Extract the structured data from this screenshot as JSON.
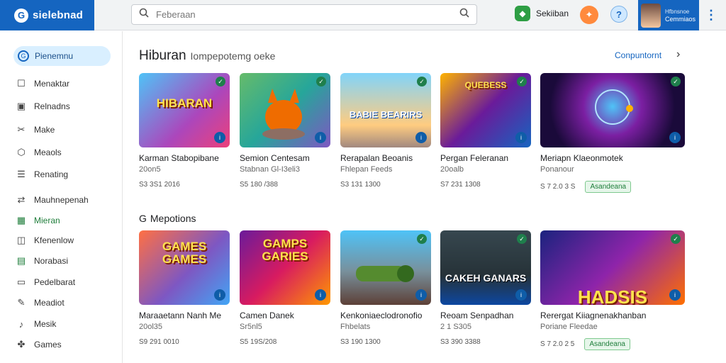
{
  "header": {
    "brand_name": "sielebnad",
    "brand_logo": "G",
    "search_placeholder": "Feberaan",
    "app_label": "Sekiiban",
    "profile_line1": "Hfbnsnoe",
    "profile_line2": "Cemmiaos"
  },
  "sidebar": {
    "active": "Pienemnu",
    "items": [
      {
        "label": "Menaktar",
        "icon": "square-icon"
      },
      {
        "label": "Relnadns",
        "icon": "calendar-icon"
      },
      {
        "label": "Make",
        "icon": "tools-icon"
      },
      {
        "label": "Meaols",
        "icon": "shield-icon"
      },
      {
        "label": "Renating",
        "icon": "list-icon"
      },
      {
        "label": "Mauhnepenah",
        "icon": "swap-icon"
      },
      {
        "label": "Mieran",
        "icon": "grid-icon"
      },
      {
        "label": "Kfenenlow",
        "icon": "box-icon"
      },
      {
        "label": "Norabasi",
        "icon": "note-icon"
      },
      {
        "label": "Pedelbarat",
        "icon": "doc-icon"
      },
      {
        "label": "Meadiot",
        "icon": "pen-icon"
      },
      {
        "label": "Mesik",
        "icon": "music-icon"
      },
      {
        "label": "Games",
        "icon": "game-icon"
      }
    ]
  },
  "main": {
    "section1_title": "Hiburan",
    "section1_sub": "Iompepotemg oeke",
    "see_all": "Conpuntornt",
    "section2_title": "Mepotions",
    "row1": [
      {
        "thumb": "HIBARAN",
        "title": "Karman Stabopibane",
        "sub": "20on5",
        "meta": "S3 3S1 2016",
        "pill": ""
      },
      {
        "thumb": "",
        "title": "Semion Centesam",
        "sub": "Stabnan Gl-I3eli3",
        "meta": "S5 180 /388",
        "pill": ""
      },
      {
        "thumb": "BABIE BEARIRS",
        "title": "Rerapalan Beoanis",
        "sub": "Fhlepan Feeds",
        "meta": "S3 131 1300",
        "pill": ""
      },
      {
        "thumb": "QUEBESS",
        "title": "Pergan Feleranan",
        "sub": "20oalb",
        "meta": "S7 231 1308",
        "pill": ""
      },
      {
        "thumb": "",
        "title": "Meriapn Klaeonmotek",
        "sub": "Ponanour",
        "meta": "S 7 2.0 3 S",
        "pill": "Asandeana"
      }
    ],
    "row2": [
      {
        "thumb": "GAMES GAMES",
        "title": "Maraaetann Nanh Me",
        "sub": "20ol35",
        "meta": "S9 291 0010",
        "pill": ""
      },
      {
        "thumb": "GAMPS GARIES",
        "title": "Camen Danek",
        "sub": "Sr5nl5",
        "meta": "S5 19S/208",
        "pill": ""
      },
      {
        "thumb": "",
        "title": "Kenkoniaeclodronofio",
        "sub": "Fhbelats",
        "meta": "S3 190 1300",
        "pill": ""
      },
      {
        "thumb": "CAKEH GANARS",
        "title": "Reoam Senpadhan",
        "sub": "2 1 S305",
        "meta": "S3 390 3388",
        "pill": ""
      },
      {
        "thumb": "HADSIS",
        "title": "Rerergat Kiiagnenakhanban",
        "sub": "Poriane Fleedae",
        "meta": "S 7 2.0 2 5",
        "pill": "Asandeana"
      }
    ]
  },
  "colors": {
    "brand": "#1565c0",
    "active_bg": "#d9efff",
    "accent_green": "#1e7d3a"
  }
}
